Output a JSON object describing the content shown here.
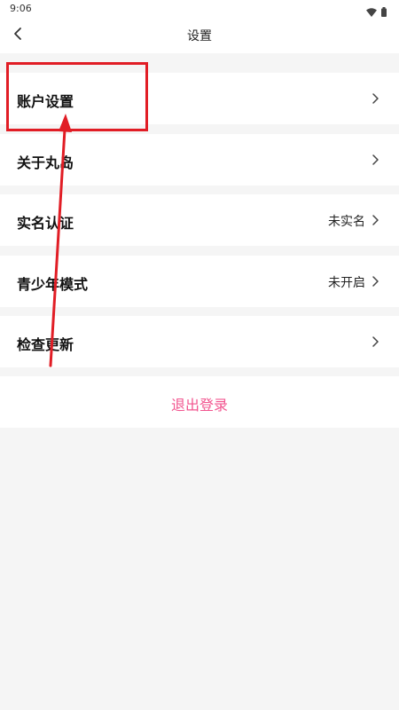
{
  "status_bar": {
    "time": "9:06",
    "icons": [
      "wifi-icon",
      "battery-icon"
    ]
  },
  "header": {
    "title": "设置",
    "back_icon": "chevron-left-icon"
  },
  "settings": {
    "items": [
      {
        "label": "账户设置",
        "value": ""
      },
      {
        "label": "关于丸岛",
        "value": ""
      },
      {
        "label": "实名认证",
        "value": "未实名"
      },
      {
        "label": "青少年模式",
        "value": "未开启"
      },
      {
        "label": "检查更新",
        "value": ""
      }
    ],
    "chevron_icon": "chevron-right-icon"
  },
  "logout": {
    "label": "退出登录",
    "color": "#f2558f"
  },
  "annotation": {
    "box_color": "#e11d25",
    "arrow_color": "#e11d25"
  }
}
